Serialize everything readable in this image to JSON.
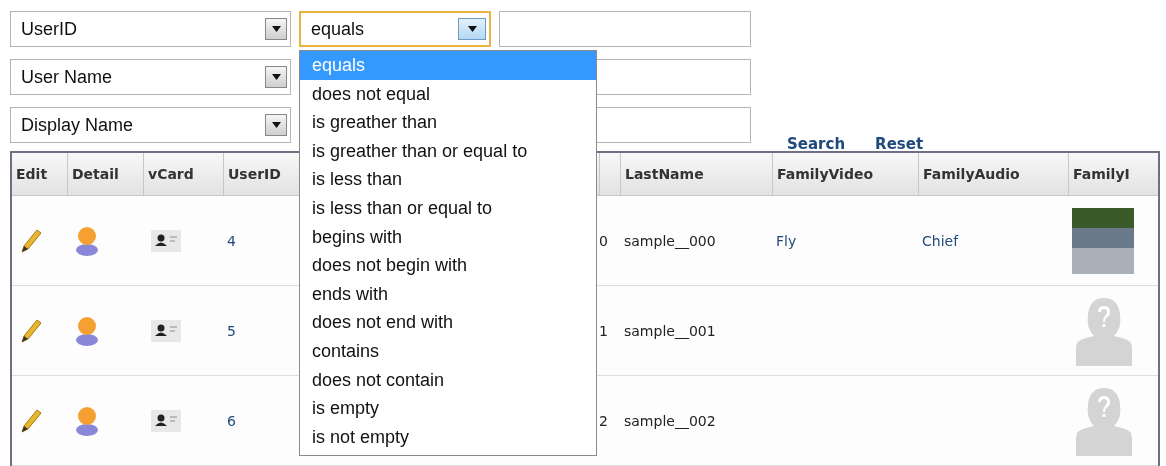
{
  "filters": [
    {
      "field": "UserID",
      "operator": "equals",
      "operator_focused": true
    },
    {
      "field": "User Name"
    },
    {
      "field": "Display Name"
    }
  ],
  "actions": [
    "Search",
    "Reset"
  ],
  "operator_menu": {
    "options": [
      {
        "label": "equals",
        "selected": true
      },
      {
        "label": "does not equal",
        "selected": false
      },
      {
        "label": "is greather than",
        "selected": false
      },
      {
        "label": "is greather than or equal to",
        "selected": false
      },
      {
        "label": "is less than",
        "selected": false
      },
      {
        "label": "is less than or equal to",
        "selected": false
      },
      {
        "label": "begins with",
        "selected": false
      },
      {
        "label": "does not begin with",
        "selected": false
      },
      {
        "label": "ends with",
        "selected": false
      },
      {
        "label": "does not end with",
        "selected": false
      },
      {
        "label": "contains",
        "selected": false
      },
      {
        "label": "does not contain",
        "selected": false
      },
      {
        "label": "is empty",
        "selected": false
      },
      {
        "label": "is not empty",
        "selected": false
      }
    ]
  },
  "table": {
    "columns": [
      "Edit",
      "Detail",
      "vCard",
      "UserID",
      "",
      "",
      "LastName",
      "FamilyVideo",
      "FamilyAudio",
      "FamilyI"
    ],
    "rows": [
      {
        "user_id": "4",
        "column_5": "0",
        "last_name": "sample__000",
        "family_video": "Fly",
        "family_audio": "Chief",
        "family_image": {
          "kind": "photo"
        }
      },
      {
        "user_id": "5",
        "column_5": "1",
        "last_name": "sample__001",
        "family_image": {
          "kind": "none"
        }
      },
      {
        "user_id": "6",
        "column_5": "2",
        "last_name": "sample__002",
        "family_image": {
          "kind": "none"
        }
      }
    ]
  }
}
